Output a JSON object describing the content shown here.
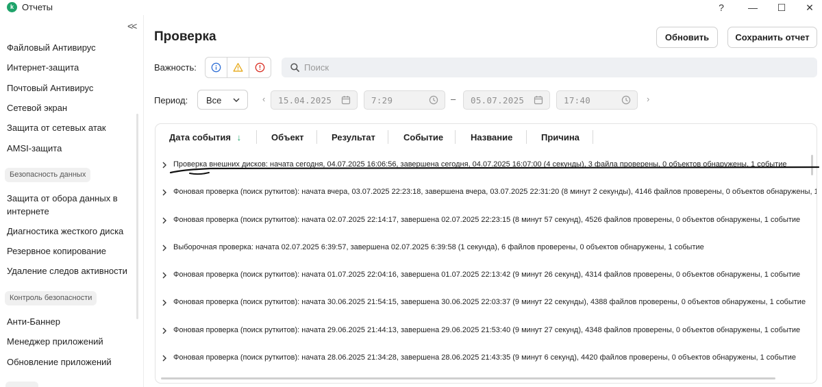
{
  "window": {
    "title": "Отчеты",
    "logo_letter": "k",
    "help_label": "?",
    "minimize_label": "—",
    "maximize_label": "☐",
    "close_label": "✕"
  },
  "sidebar": {
    "collapse_label": "<<",
    "items": [
      {
        "label": "Файловый Антивирус"
      },
      {
        "label": "Интернет-защита"
      },
      {
        "label": "Почтовый Антивирус"
      },
      {
        "label": "Сетевой экран"
      },
      {
        "label": "Защита от сетевых атак"
      },
      {
        "label": "AMSI-защита"
      }
    ],
    "group_data_security": "Безопасность данных",
    "items_data": [
      {
        "label": "Защита от обора данных в интернете"
      },
      {
        "label": "Диагностика жесткого диска"
      },
      {
        "label": "Резервное копирование"
      },
      {
        "label": "Удаление следов активности"
      }
    ],
    "group_security_control": "Контроль безопасности",
    "items_control": [
      {
        "label": "Анти-Баннер"
      },
      {
        "label": "Менеджер приложений"
      },
      {
        "label": "Обновление приложений"
      }
    ]
  },
  "main": {
    "title": "Проверка",
    "refresh_label": "Обновить",
    "save_report_label": "Сохранить отчет",
    "severity_label": "Важность:",
    "search_placeholder": "Поиск",
    "period_label": "Период:",
    "period_value": "Все",
    "date_from": "15.04.2025",
    "time_from": "7:29",
    "date_to": "05.07.2025",
    "time_to": "17:40",
    "range_dash": "–",
    "prev_arrow": "‹",
    "next_arrow": "›"
  },
  "table": {
    "columns": [
      "Дата события",
      "Объект",
      "Результат",
      "Событие",
      "Название",
      "Причина"
    ],
    "sort_indicator": "↓",
    "rows": [
      "Проверка внешних дисков: начата сегодня, 04.07.2025 16:06:56, завершена сегодня, 04.07.2025 16:07:00 (4 секунды), 3 файла проверены, 0 объектов обнаружены, 1 событие",
      "Фоновая проверка (поиск руткитов): начата вчера, 03.07.2025 22:23:18, завершена вчера, 03.07.2025 22:31:20 (8 минут 2 секунды), 4146 файлов проверены, 0 объектов обнаружены, 1",
      "Фоновая проверка (поиск руткитов): начата 02.07.2025 22:14:17, завершена 02.07.2025 22:23:15 (8 минут 57 секунд), 4526 файлов проверены, 0 объектов обнаружены, 1 событие",
      "Выборочная проверка: начата 02.07.2025 6:39:57, завершена 02.07.2025 6:39:58 (1 секунда), 6 файлов проверены, 0 объектов обнаружены, 1 событие",
      "Фоновая проверка (поиск руткитов): начата 01.07.2025 22:04:16, завершена 01.07.2025 22:13:42 (9 минут 26 секунд), 4314 файлов проверены, 0 объектов обнаружены, 1 событие",
      "Фоновая проверка (поиск руткитов): начата 30.06.2025 21:54:15, завершена 30.06.2025 22:03:37 (9 минут 22 секунды), 4388 файлов проверены, 0 объектов обнаружены, 1 событие",
      "Фоновая проверка (поиск руткитов): начата 29.06.2025 21:44:13, завершена 29.06.2025 21:53:40 (9 минут 27 секунд), 4348 файлов проверены, 0 объектов обнаружены, 1 событие",
      "Фоновая проверка (поиск руткитов): начата 28.06.2025 21:34:28, завершена 28.06.2025 21:43:35 (9 минут 6 секунд), 4420 файлов проверены, 0 объектов обнаружены, 1 событие"
    ]
  },
  "colors": {
    "brand": "#1fa36a",
    "info": "#2f6fd6",
    "warning": "#e6a817",
    "error": "#d93025",
    "sort_arrow": "#1fa36a"
  },
  "icons": [
    "app-logo-icon",
    "help-icon",
    "minimize-icon",
    "maximize-icon",
    "close-icon",
    "collapse-icon",
    "info-icon",
    "warning-icon",
    "error-icon",
    "search-icon",
    "chevron-down-icon",
    "calendar-icon",
    "clock-icon",
    "chevron-right-icon"
  ]
}
